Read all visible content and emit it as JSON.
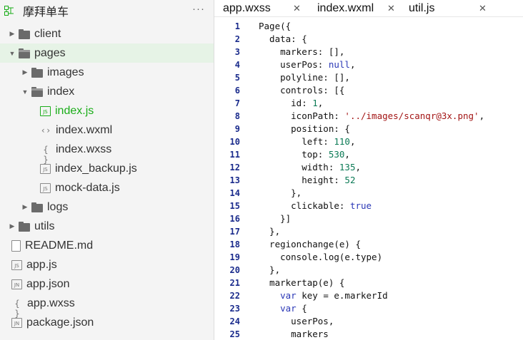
{
  "sidebar": {
    "title": "摩拜单车",
    "more_label": "···",
    "tree": [
      {
        "label": "client",
        "type": "folder",
        "arrow": "▶",
        "indent": 0
      },
      {
        "label": "pages",
        "type": "folder-open",
        "arrow": "▼",
        "indent": 0,
        "active": true
      },
      {
        "label": "images",
        "type": "folder",
        "arrow": "▶",
        "indent": 1
      },
      {
        "label": "index",
        "type": "folder-open",
        "arrow": "▼",
        "indent": 1
      },
      {
        "label": "index.js",
        "type": "js",
        "indent": 2,
        "selected": true
      },
      {
        "label": "index.wxml",
        "type": "wxml",
        "indent": 2
      },
      {
        "label": "index.wxss",
        "type": "wxss",
        "indent": 2
      },
      {
        "label": "index_backup.js",
        "type": "js",
        "indent": 2
      },
      {
        "label": "mock-data.js",
        "type": "js",
        "indent": 2
      },
      {
        "label": "logs",
        "type": "folder",
        "arrow": "▶",
        "indent": 1
      },
      {
        "label": "utils",
        "type": "folder",
        "arrow": "▶",
        "indent": 0
      },
      {
        "label": "README.md",
        "type": "doc",
        "indent": 0
      },
      {
        "label": "app.js",
        "type": "js",
        "indent": 0
      },
      {
        "label": "app.json",
        "type": "json",
        "indent": 0
      },
      {
        "label": "app.wxss",
        "type": "wxss",
        "indent": 0
      },
      {
        "label": "package.json",
        "type": "json",
        "indent": 0
      }
    ]
  },
  "tabs": [
    {
      "label": "app.wxss",
      "close": "✕"
    },
    {
      "label": "index.wxml",
      "close": "✕"
    },
    {
      "label": "util.js",
      "close": "✕"
    }
  ],
  "file_icons": {
    "js": "JS",
    "json": "JN",
    "wxml": "‹›",
    "wxss": "{ }"
  },
  "code": [
    {
      "n": "1",
      "t": "Page({"
    },
    {
      "n": "2",
      "t": "  data: {"
    },
    {
      "n": "3",
      "t": "    markers: [],"
    },
    {
      "n": "4",
      "t": "    userPos: null,"
    },
    {
      "n": "5",
      "t": "    polyline: [],"
    },
    {
      "n": "6",
      "t": "    controls: [{"
    },
    {
      "n": "7",
      "t": "      id: 1,"
    },
    {
      "n": "8",
      "t": "      iconPath: '../images/scanqr@3x.png',"
    },
    {
      "n": "9",
      "t": "      position: {"
    },
    {
      "n": "10",
      "t": "        left: 110,"
    },
    {
      "n": "11",
      "t": "        top: 530,"
    },
    {
      "n": "12",
      "t": "        width: 135,"
    },
    {
      "n": "13",
      "t": "        height: 52"
    },
    {
      "n": "14",
      "t": "      },"
    },
    {
      "n": "15",
      "t": "      clickable: true"
    },
    {
      "n": "16",
      "t": "    }]"
    },
    {
      "n": "17",
      "t": "  },"
    },
    {
      "n": "18",
      "t": "  regionchange(e) {"
    },
    {
      "n": "19",
      "t": "    console.log(e.type)"
    },
    {
      "n": "20",
      "t": "  },"
    },
    {
      "n": "21",
      "t": "  markertap(e) {"
    },
    {
      "n": "22",
      "t": "    var key = e.markerId"
    },
    {
      "n": "23",
      "t": "    var {"
    },
    {
      "n": "24",
      "t": "      userPos,"
    },
    {
      "n": "25",
      "t": "      markers"
    }
  ],
  "colors": {
    "accent": "#1aad19",
    "active_row_bg": "#e6f3e6",
    "line_number": "#1a2b8c",
    "keyword": "#2a37b6",
    "string": "#a31515",
    "number": "#0b7a55"
  }
}
